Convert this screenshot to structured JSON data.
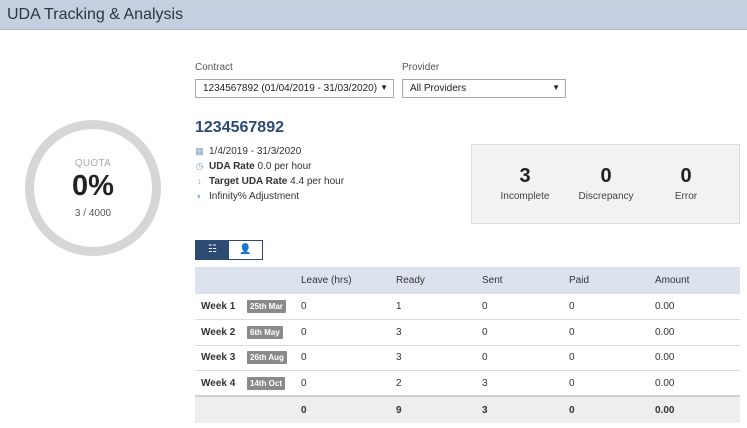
{
  "header": {
    "title": "UDA Tracking & Analysis"
  },
  "quota": {
    "label": "QUOTA",
    "percent": "0%",
    "fraction": "3 / 4000"
  },
  "contract_select": {
    "label": "Contract",
    "value": "1234567892 (01/04/2019 - 31/03/2020)"
  },
  "provider_select": {
    "label": "Provider",
    "value": "All Providers"
  },
  "contract": {
    "number": "1234567892",
    "date_range": "1/4/2019 - 31/3/2020",
    "uda_rate_label": "UDA Rate",
    "uda_rate_value": "0.0 per hour",
    "target_rate_label": "Target UDA Rate",
    "target_rate_value": "4.4 per hour",
    "adjustment": "Infinity% Adjustment"
  },
  "stats": [
    {
      "value": "3",
      "label": "Incomplete"
    },
    {
      "value": "0",
      "label": "Discrepancy"
    },
    {
      "value": "0",
      "label": "Error"
    }
  ],
  "view_toggle": {
    "active_icon": "list-icon",
    "inactive_icon": "user-icon"
  },
  "table": {
    "columns": [
      "Leave (hrs)",
      "Ready",
      "Sent",
      "Paid",
      "Amount"
    ],
    "rows": [
      {
        "week": "Week 1",
        "date": "25th Mar",
        "leave": "0",
        "ready": "1",
        "sent": "0",
        "paid": "0",
        "amount": "0.00"
      },
      {
        "week": "Week 2",
        "date": "6th May",
        "leave": "0",
        "ready": "3",
        "sent": "0",
        "paid": "0",
        "amount": "0.00"
      },
      {
        "week": "Week 3",
        "date": "26th Aug",
        "leave": "0",
        "ready": "3",
        "sent": "0",
        "paid": "0",
        "amount": "0.00"
      },
      {
        "week": "Week 4",
        "date": "14th Oct",
        "leave": "0",
        "ready": "2",
        "sent": "3",
        "paid": "0",
        "amount": "0.00"
      }
    ],
    "totals": {
      "leave": "0",
      "ready": "9",
      "sent": "3",
      "paid": "0",
      "amount": "0.00"
    }
  }
}
